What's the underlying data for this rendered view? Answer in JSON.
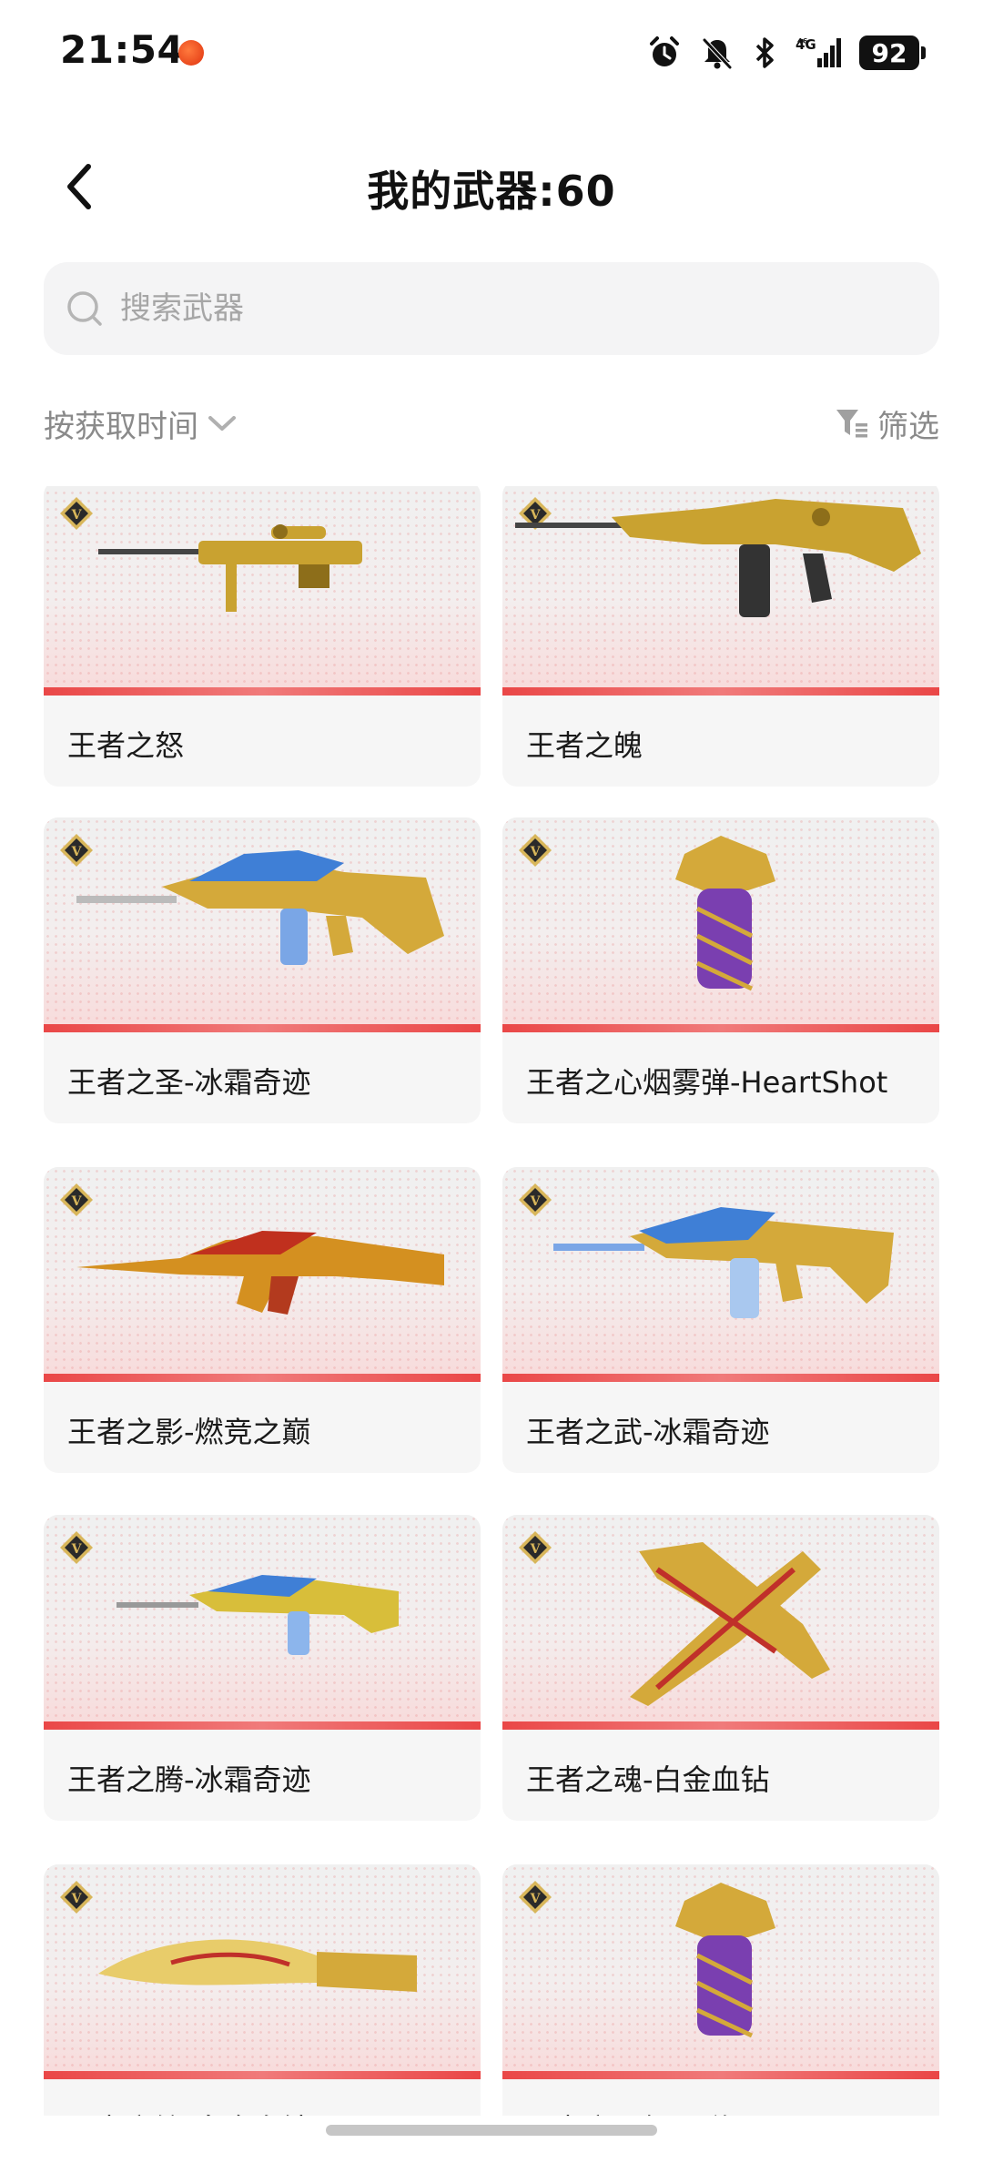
{
  "status_bar": {
    "time": "21:54",
    "network": "4G",
    "battery": "92",
    "icons": [
      "app-notification-icon",
      "alarm-icon",
      "mute-bell-icon",
      "bluetooth-icon",
      "signal-icon",
      "battery-icon"
    ]
  },
  "header": {
    "title": "我的武器:60",
    "back_icon": "chevron-left-icon"
  },
  "search": {
    "placeholder": "搜索武器",
    "value": ""
  },
  "toolbar": {
    "sort_label": "按获取时间",
    "filter_label": "筛选"
  },
  "colors": {
    "accent_red": "#ea4747",
    "card_bg": "#f6f6f6",
    "muted_text": "#8a8a8a",
    "gold": "#d4a93a"
  },
  "weapons": [
    {
      "name": "王者之怒",
      "badge": "V",
      "art": "sniper-rifle"
    },
    {
      "name": "王者之魄",
      "badge": "V",
      "art": "assault-rifle"
    },
    {
      "name": "王者之圣-冰霜奇迹",
      "badge": "V",
      "art": "assault-rifle-blue"
    },
    {
      "name": "王者之心烟雾弹-HeartShot",
      "badge": "V",
      "art": "smoke-grenade"
    },
    {
      "name": "王者之影-燃竞之巅",
      "badge": "V",
      "art": "ak-rifle-flame"
    },
    {
      "name": "王者之武-冰霜奇迹",
      "badge": "V",
      "art": "assault-rifle-blue"
    },
    {
      "name": "王者之腾-冰霜奇迹",
      "badge": "V",
      "art": "assault-rifle-blue"
    },
    {
      "name": "王者之魂-白金血钻",
      "badge": "V",
      "art": "pistol-crossed"
    },
    {
      "name": "王者之锋-白金血钻",
      "badge": "V",
      "art": "knife"
    },
    {
      "name": "王者之心烟雾弹-HeartShot",
      "badge": "V",
      "art": "smoke-grenade"
    }
  ]
}
